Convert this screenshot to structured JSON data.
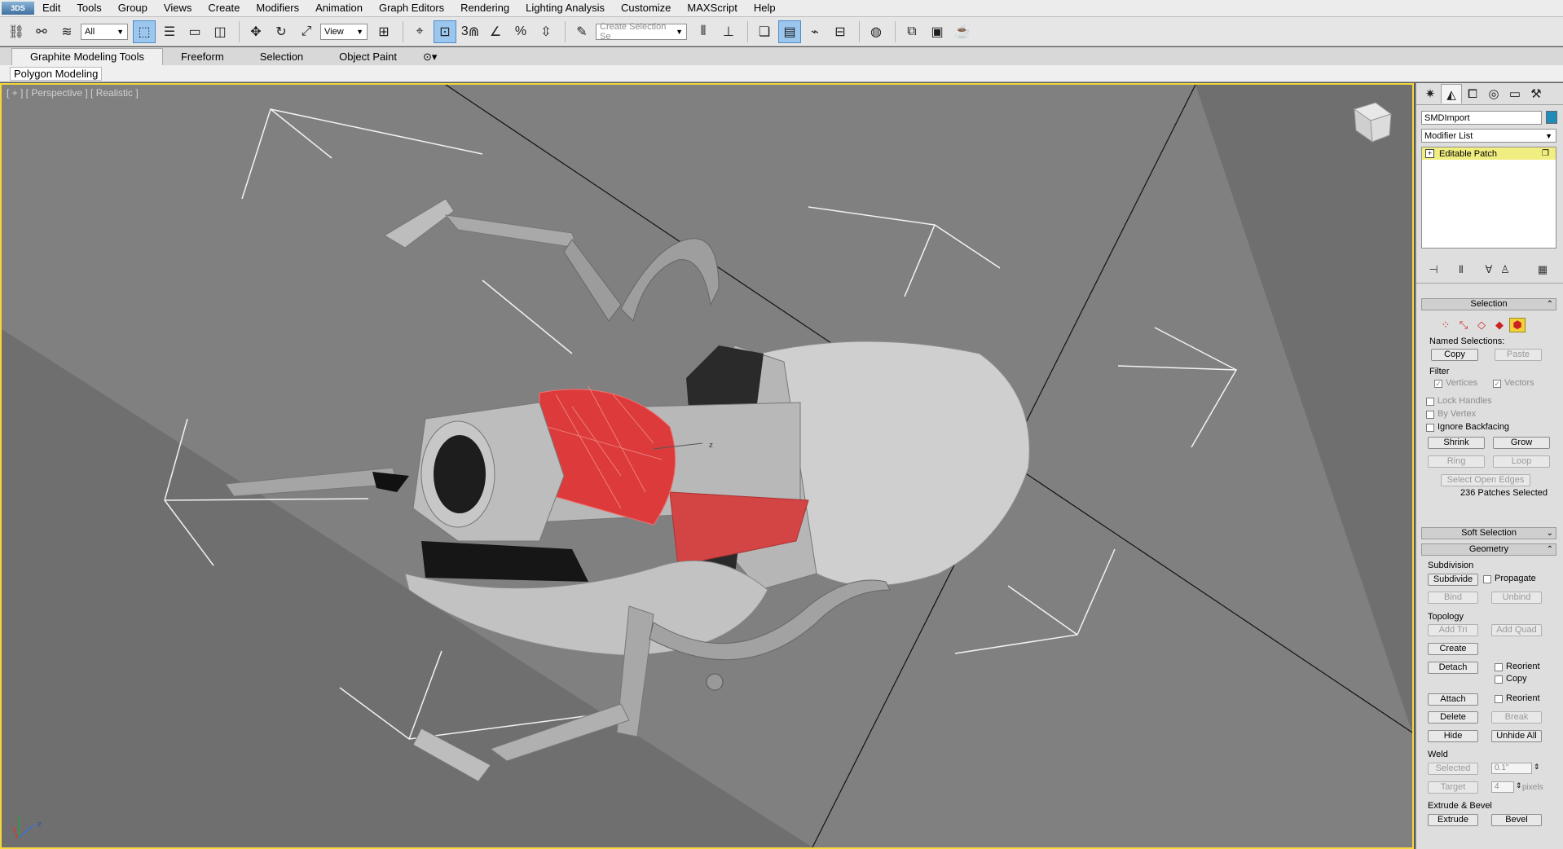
{
  "app": {
    "logo_text": "3DS"
  },
  "menu": [
    "Edit",
    "Tools",
    "Group",
    "Views",
    "Create",
    "Modifiers",
    "Animation",
    "Graph Editors",
    "Rendering",
    "Lighting Analysis",
    "Customize",
    "MAXScript",
    "Help"
  ],
  "toolbar": {
    "selection_filter": "All",
    "ref_coord": "View",
    "snap_label": "3",
    "named_selection_placeholder": "Create Selection Se"
  },
  "ribbon": {
    "tabs": [
      "Graphite Modeling Tools",
      "Freeform",
      "Selection",
      "Object Paint"
    ],
    "active_tab": "Graphite Modeling Tools",
    "sub_label": "Polygon Modeling"
  },
  "viewport": {
    "label": "[ + ] [ Perspective ] [ Realistic ]",
    "axis_z": "z",
    "axis_x": "x",
    "gizmo_z": "z"
  },
  "panel": {
    "object_name": "SMDImport",
    "object_color": "#1f8db7",
    "modifier_list": "Modifier List",
    "stack": [
      {
        "label": "Editable Patch",
        "color": "#f0ee80"
      }
    ],
    "selection": {
      "title": "Selection",
      "named_selections": "Named Selections:",
      "copy": "Copy",
      "paste": "Paste",
      "filter": "Filter",
      "vertices": "Vertices",
      "vectors": "Vectors",
      "lock_handles": "Lock Handles",
      "by_vertex": "By Vertex",
      "ignore_backfacing": "Ignore Backfacing",
      "shrink": "Shrink",
      "grow": "Grow",
      "ring": "Ring",
      "loop": "Loop",
      "select_open_edges": "Select Open Edges",
      "status": "236 Patches Selected"
    },
    "soft_selection": {
      "title": "Soft Selection"
    },
    "geometry": {
      "title": "Geometry",
      "subdivision": "Subdivision",
      "subdivide": "Subdivide",
      "propagate": "Propagate",
      "bind": "Bind",
      "unbind": "Unbind",
      "topology": "Topology",
      "add_tri": "Add Tri",
      "add_quad": "Add Quad",
      "create": "Create",
      "detach": "Detach",
      "reorient": "Reorient",
      "copy": "Copy",
      "attach": "Attach",
      "reorient2": "Reorient",
      "delete": "Delete",
      "break": "Break",
      "hide": "Hide",
      "unhide_all": "Unhide All",
      "weld": "Weld",
      "selected": "Selected",
      "weld_threshold": "0.1\"",
      "target": "Target",
      "target_pixels": "4",
      "pixels": "pixels",
      "extrude_bevel": "Extrude & Bevel",
      "extrude": "Extrude",
      "bevel": "Bevel"
    }
  }
}
